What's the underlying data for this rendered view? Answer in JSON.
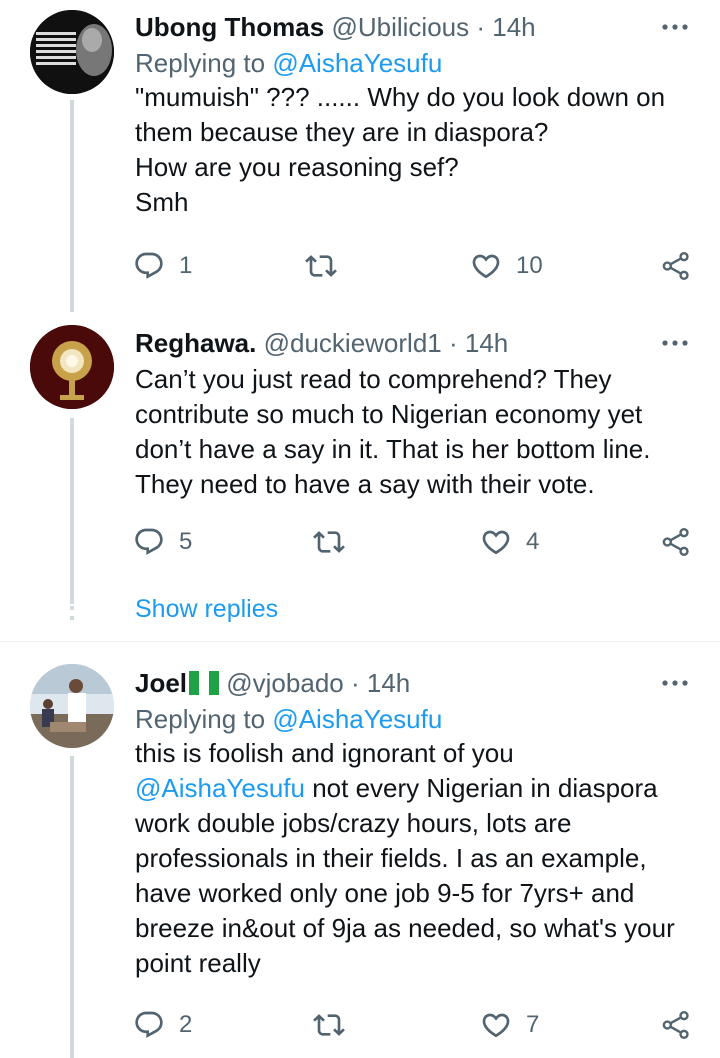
{
  "tweets": [
    {
      "name": "Ubong Thomas",
      "handle": "@Ubilicious",
      "separator": "·",
      "time": "14h",
      "replying_prefix": "Replying to ",
      "replying_to": "@AishaYesufu",
      "lines": [
        "\"mumuish\" ??? ...... Why do you look down on",
        "them because they are in diaspora?",
        "How are you reasoning sef?",
        "Smh"
      ],
      "reply_count": "1",
      "retweet_count": "",
      "like_count": "10"
    },
    {
      "name": "Reghawa.",
      "handle": "@duckieworld1",
      "separator": "·",
      "time": "14h",
      "lines": [
        "Can’t you just read to comprehend? They",
        "contribute so much to Nigerian economy yet",
        "don’t have a say in it. That is her bottom line.",
        "They need to have a say with their vote."
      ],
      "reply_count": "5",
      "retweet_count": "",
      "like_count": "4"
    },
    {
      "name": "Joel",
      "handle": "@vjobado",
      "separator": "·",
      "time": "14h",
      "replying_prefix": "Replying to ",
      "replying_to": "@AishaYesufu",
      "line1": "this is foolish and ignorant of you",
      "mention": "@AishaYesufu",
      "line2_rest": " not every Nigerian in diaspora",
      "lines": [
        "work double jobs/crazy hours, lots are",
        "professionals in their fields. I as an example,",
        "have worked only one job 9-5 for 7yrs+ and",
        "breeze in&out of 9ja as needed, so what's your",
        "point really"
      ],
      "reply_count": "2",
      "retweet_count": "",
      "like_count": "7"
    }
  ],
  "show_replies": "Show replies",
  "colors": {
    "accent": "#1d9bf0",
    "secondary_text": "#536471",
    "thread_line": "#cfd9de",
    "flag_green": "#1fa245"
  },
  "icons": [
    "more-icon",
    "reply-icon",
    "retweet-icon",
    "like-icon",
    "share-icon",
    "nigeria-flag-icon"
  ]
}
